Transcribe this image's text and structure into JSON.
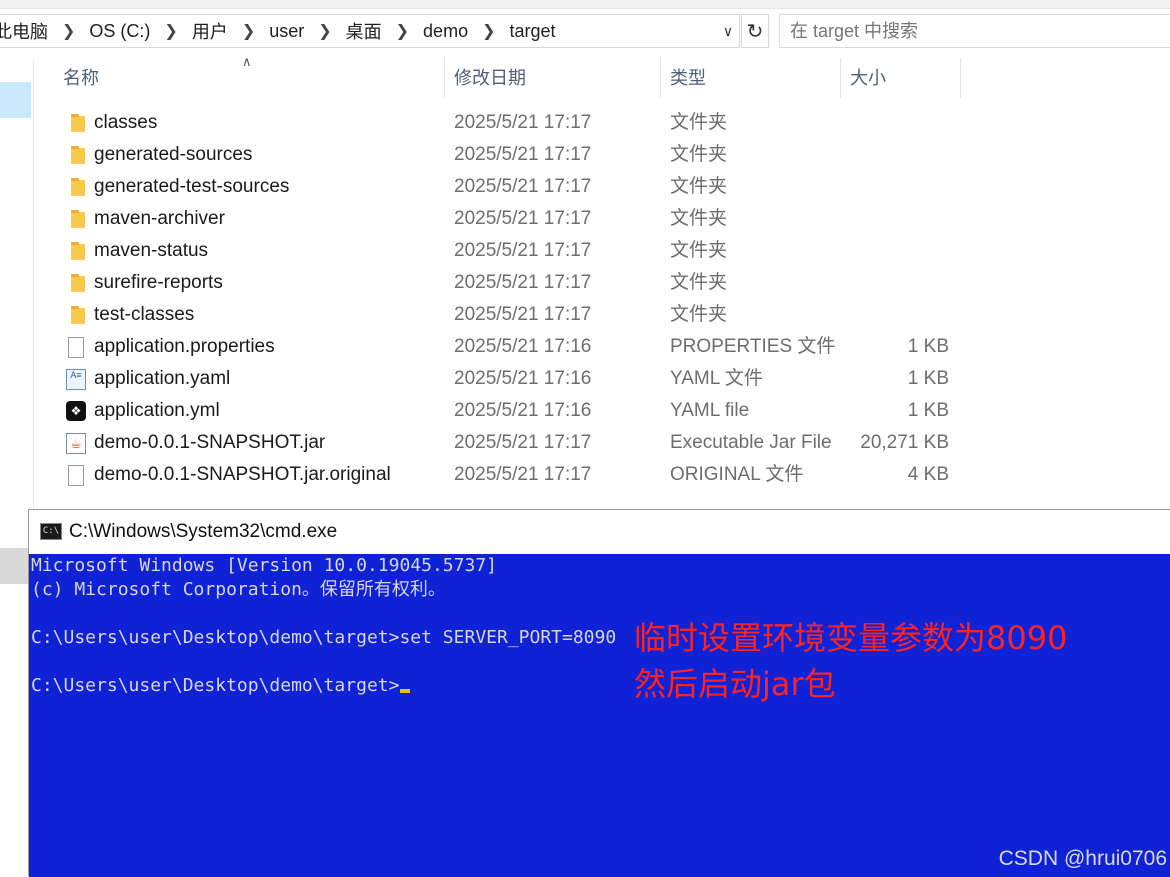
{
  "address": {
    "crumbs": [
      "此电脑",
      "OS (C:)",
      "用户",
      "user",
      "桌面",
      "demo",
      "target"
    ]
  },
  "search": {
    "placeholder": "在 target 中搜索"
  },
  "columns": {
    "name": "名称",
    "date": "修改日期",
    "type": "类型",
    "size": "大小"
  },
  "files": [
    {
      "name": "classes",
      "date": "2025/5/21 17:17",
      "type": "文件夹",
      "size": "",
      "icon": "folder-icon"
    },
    {
      "name": "generated-sources",
      "date": "2025/5/21 17:17",
      "type": "文件夹",
      "size": "",
      "icon": "folder-icon"
    },
    {
      "name": "generated-test-sources",
      "date": "2025/5/21 17:17",
      "type": "文件夹",
      "size": "",
      "icon": "folder-icon"
    },
    {
      "name": "maven-archiver",
      "date": "2025/5/21 17:17",
      "type": "文件夹",
      "size": "",
      "icon": "folder-icon"
    },
    {
      "name": "maven-status",
      "date": "2025/5/21 17:17",
      "type": "文件夹",
      "size": "",
      "icon": "folder-icon"
    },
    {
      "name": "surefire-reports",
      "date": "2025/5/21 17:17",
      "type": "文件夹",
      "size": "",
      "icon": "folder-icon"
    },
    {
      "name": "test-classes",
      "date": "2025/5/21 17:17",
      "type": "文件夹",
      "size": "",
      "icon": "folder-icon"
    },
    {
      "name": "application.properties",
      "date": "2025/5/21 17:16",
      "type": "PROPERTIES 文件",
      "size": "1 KB",
      "icon": "file-icon"
    },
    {
      "name": "application.yaml",
      "date": "2025/5/21 17:16",
      "type": "YAML 文件",
      "size": "1 KB",
      "icon": "yaml-icon"
    },
    {
      "name": "application.yml",
      "date": "2025/5/21 17:16",
      "type": "YAML file",
      "size": "1 KB",
      "icon": "yml-app-icon"
    },
    {
      "name": "demo-0.0.1-SNAPSHOT.jar",
      "date": "2025/5/21 17:17",
      "type": "Executable Jar File",
      "size": "20,271 KB",
      "icon": "jar-icon"
    },
    {
      "name": "demo-0.0.1-SNAPSHOT.jar.original",
      "date": "2025/5/21 17:17",
      "type": "ORIGINAL 文件",
      "size": "4 KB",
      "icon": "file-icon"
    }
  ],
  "cmd": {
    "title": "C:\\Windows\\System32\\cmd.exe",
    "lines": [
      "Microsoft Windows [Version 10.0.19045.5737]",
      "(c) Microsoft Corporation。保留所有权利。",
      "",
      "C:\\Users\\user\\Desktop\\demo\\target>set SERVER_PORT=8090",
      "",
      "C:\\Users\\user\\Desktop\\demo\\target>"
    ],
    "annotation": [
      "临时设置环境变量参数为8090",
      "然后启动jar包"
    ]
  },
  "watermark": "CSDN @hrui0706",
  "colors": {
    "console_bg": "#0f22d6",
    "annotation": "#ff2222",
    "folder": "#f8c94c",
    "selection": "#cce8ff"
  }
}
